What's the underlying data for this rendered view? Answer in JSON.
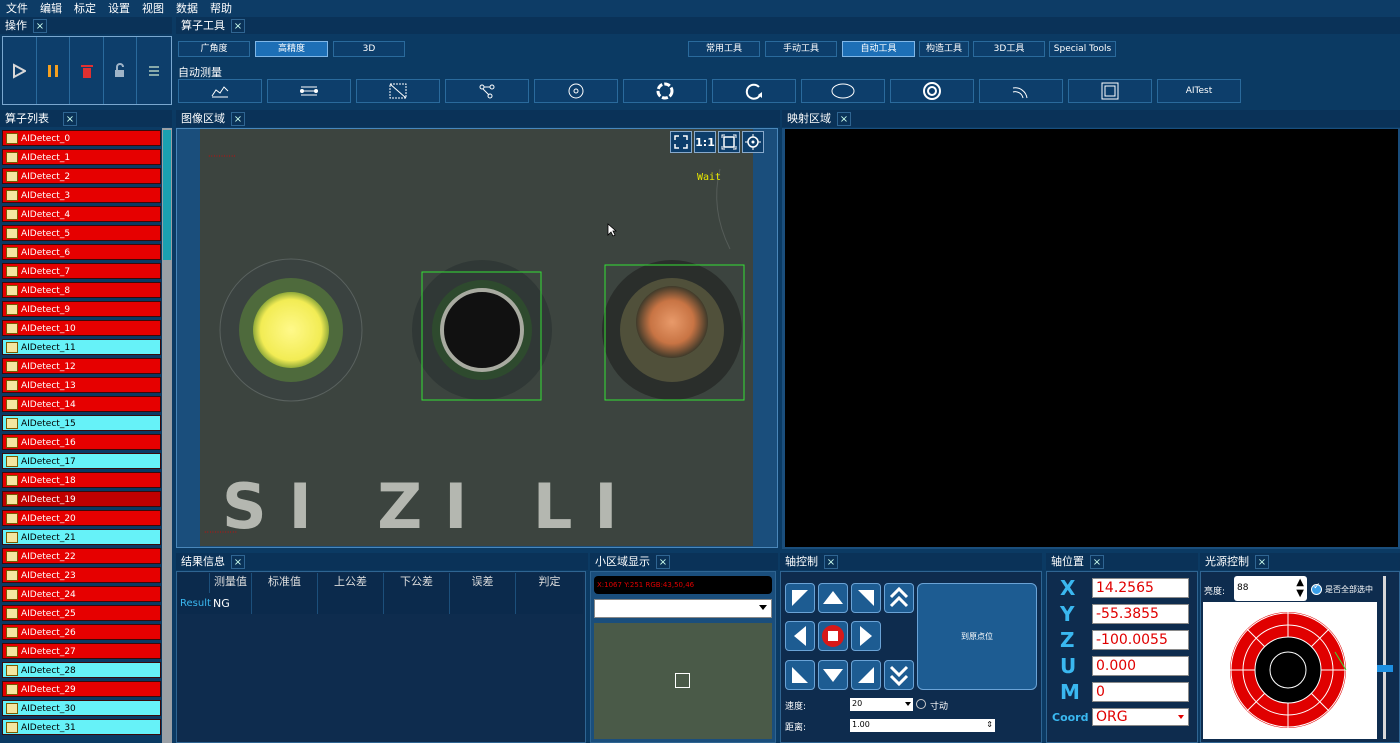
{
  "menu": [
    "文件",
    "编辑",
    "标定",
    "设置",
    "视图",
    "数据",
    "帮助"
  ],
  "panels": {
    "ops": "操作",
    "algo_tools": "算子工具",
    "algo_list": "算子列表",
    "image_area": "图像区域",
    "map_area": "映射区域",
    "result": "结果信息",
    "small_area": "小区域显示",
    "axis_ctrl": "轴控制",
    "axis_pos": "轴位置",
    "light_ctrl": "光源控制"
  },
  "lens_tabs": [
    "广角度",
    "高精度",
    "3D"
  ],
  "tool_tabs": [
    "常用工具",
    "手动工具",
    "自动工具",
    "构造工具",
    "3D工具",
    "Special Tools"
  ],
  "auto_measure_label": "自动测量",
  "tool_last_label": "AITest",
  "algo_items": [
    {
      "label": "AIDetect_0",
      "state": "red"
    },
    {
      "label": "AIDetect_1",
      "state": "red"
    },
    {
      "label": "AIDetect_2",
      "state": "red"
    },
    {
      "label": "AIDetect_3",
      "state": "red"
    },
    {
      "label": "AIDetect_4",
      "state": "red"
    },
    {
      "label": "AIDetect_5",
      "state": "red"
    },
    {
      "label": "AIDetect_6",
      "state": "red"
    },
    {
      "label": "AIDetect_7",
      "state": "red"
    },
    {
      "label": "AIDetect_8",
      "state": "red"
    },
    {
      "label": "AIDetect_9",
      "state": "red"
    },
    {
      "label": "AIDetect_10",
      "state": "red"
    },
    {
      "label": "AIDetect_11",
      "state": "cyan"
    },
    {
      "label": "AIDetect_12",
      "state": "red"
    },
    {
      "label": "AIDetect_13",
      "state": "red"
    },
    {
      "label": "AIDetect_14",
      "state": "red"
    },
    {
      "label": "AIDetect_15",
      "state": "cyan"
    },
    {
      "label": "AIDetect_16",
      "state": "red"
    },
    {
      "label": "AIDetect_17",
      "state": "cyan"
    },
    {
      "label": "AIDetect_18",
      "state": "red"
    },
    {
      "label": "AIDetect_19",
      "state": "dark"
    },
    {
      "label": "AIDetect_20",
      "state": "red"
    },
    {
      "label": "AIDetect_21",
      "state": "cyan"
    },
    {
      "label": "AIDetect_22",
      "state": "red"
    },
    {
      "label": "AIDetect_23",
      "state": "red"
    },
    {
      "label": "AIDetect_24",
      "state": "red"
    },
    {
      "label": "AIDetect_25",
      "state": "red"
    },
    {
      "label": "AIDetect_26",
      "state": "red"
    },
    {
      "label": "AIDetect_27",
      "state": "red"
    },
    {
      "label": "AIDetect_28",
      "state": "cyan"
    },
    {
      "label": "AIDetect_29",
      "state": "red"
    },
    {
      "label": "AIDetect_30",
      "state": "cyan"
    },
    {
      "label": "AIDetect_31",
      "state": "cyan"
    }
  ],
  "image": {
    "wait_text": "Wait",
    "silk_text": "SI ZI LI"
  },
  "result_headers": [
    "测量值",
    "标准值",
    "上公差",
    "下公差",
    "误差",
    "判定"
  ],
  "result_row": {
    "label": "Result",
    "value": "NG"
  },
  "small_area": {
    "pixel_info": "X:1067  Y:251  RGB:43,50,46"
  },
  "axis": {
    "speed_label": "速度:",
    "speed_value": "20",
    "jog_label": "寸动",
    "distance_label": "距离:",
    "distance_value": "1.00",
    "home_label": "到原点位"
  },
  "axis_pos": {
    "X": "14.2565",
    "Y": "-55.3855",
    "Z": "-100.0055",
    "U": "0.000",
    "M": "0",
    "coord_label": "Coord",
    "coord_value": "ORG"
  },
  "light": {
    "height_label": "亮度:",
    "height_value": "88",
    "select_all_label": "是否全部选中"
  },
  "colors": {
    "accent_blue": "#1d6fb6",
    "error_red": "#e60000",
    "ok_cyan": "#66f2f8",
    "detect_green": "#35e035"
  }
}
